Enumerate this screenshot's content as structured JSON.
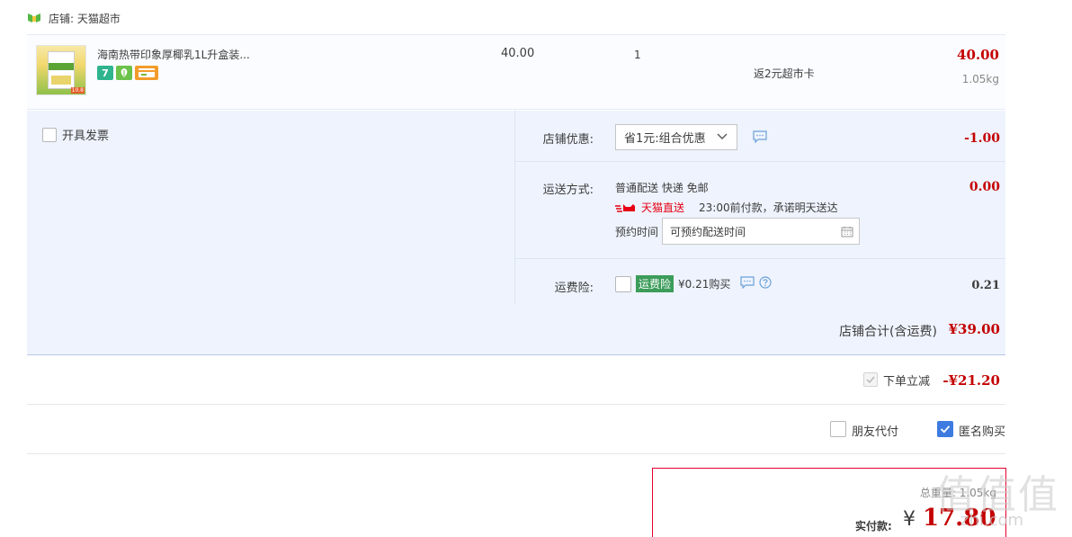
{
  "shop": {
    "name": "店铺: 天猫超市"
  },
  "item": {
    "title": "海南热带印象厚椰乳1L升盒装...",
    "price": "40.00",
    "quantity": "1",
    "rebate": "返2元超市卡",
    "total": "40.00",
    "weight": "1.05kg",
    "thumb_text": "10.8",
    "badges": [
      "7",
      "leaf",
      "card"
    ]
  },
  "invoice": {
    "label": "开具发票"
  },
  "shop_discount": {
    "label": "店铺优惠:",
    "selected": "省1元:组合优惠",
    "amount": "-1.00"
  },
  "shipping": {
    "label": "运送方式:",
    "method": "普通配送 快递 免邮",
    "express_brand": "天猫直送",
    "promise": "23:00前付款，承诺明天送达",
    "appointment_label": "预约时间",
    "appointment_placeholder": "可预约配送时间",
    "amount": "0.00"
  },
  "insurance": {
    "label": "运费险:",
    "badge": "运费险",
    "text": "¥0.21购买",
    "amount": "0.21"
  },
  "shop_total": {
    "label": "店铺合计(含运费)",
    "value": "¥39.00"
  },
  "order_discount": {
    "label": "下单立减",
    "value": "-¥21.20",
    "checked": true
  },
  "payment_options": {
    "friend_pay": "朋友代付",
    "anonymous": "匿名购买",
    "anonymous_checked": true
  },
  "summary": {
    "weight": "总重量: 1.05kg",
    "pay_label": "实付款:",
    "currency": "¥",
    "amount": "17.80"
  },
  "watermark": {
    "text": "值 值 值",
    "url": "zhi.com"
  },
  "colors": {
    "price_red": "#c40000",
    "panel_blue": "#eef3fd",
    "checkbox_blue": "#3d7be0",
    "insurance_green": "#3c9c5a",
    "tmall_red": "#e60012"
  }
}
